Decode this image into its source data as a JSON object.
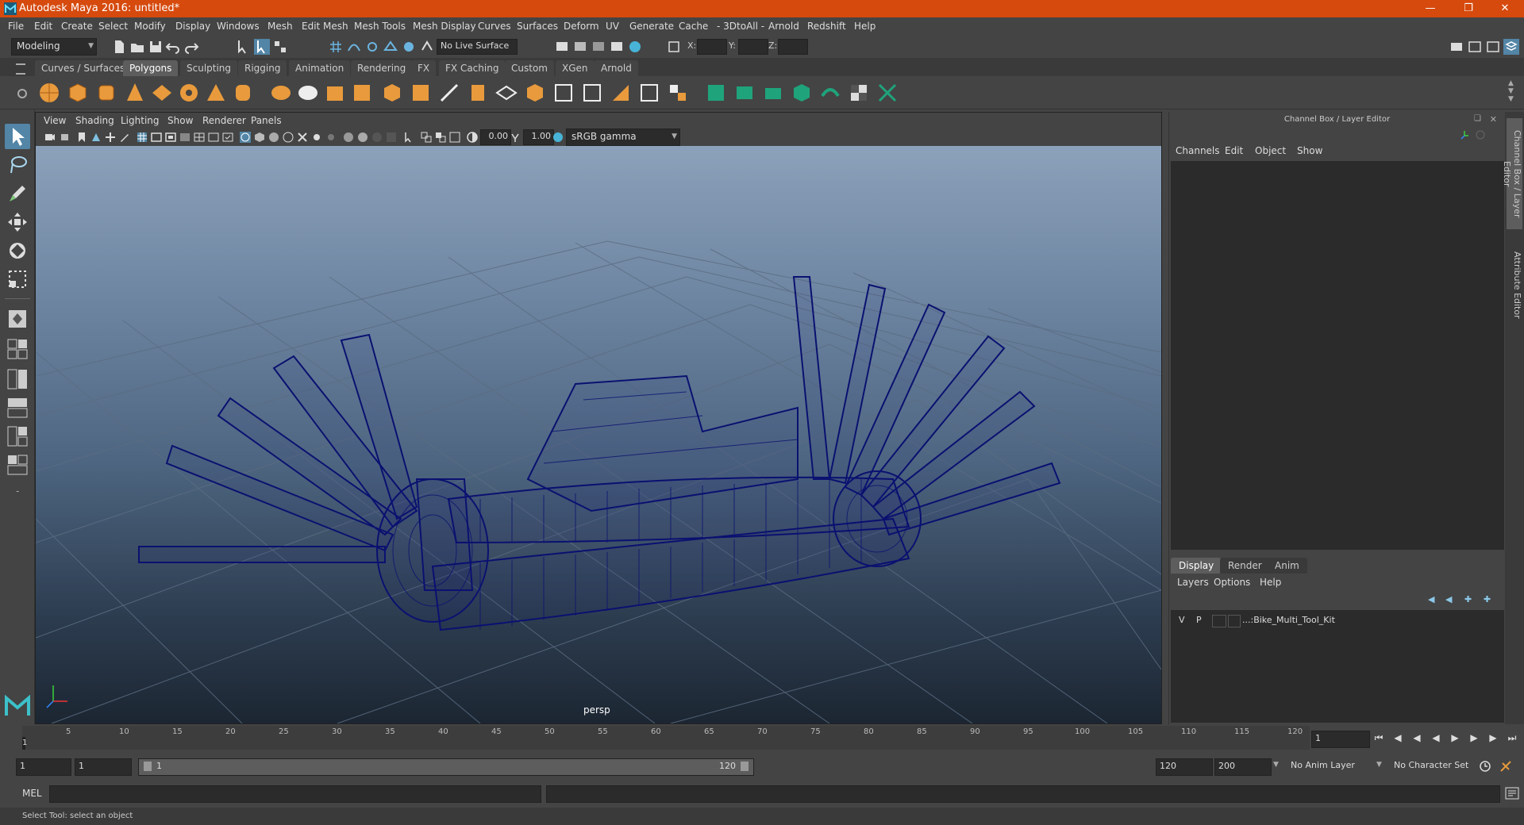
{
  "window": {
    "title": "Autodesk Maya 2016: untitled*"
  },
  "menubar": [
    "File",
    "Edit",
    "Create",
    "Select",
    "Modify",
    "Display",
    "Windows",
    "Mesh",
    "Edit Mesh",
    "Mesh Tools",
    "Mesh Display",
    "Curves",
    "Surfaces",
    "Deform",
    "UV",
    "Generate",
    "Cache",
    "- 3DtoAll -",
    "Arnold",
    "Redshift",
    "Help"
  ],
  "statusline": {
    "menuset": "Modeling",
    "live_surface": "No Live Surface",
    "x_label": "X:",
    "y_label": "Y:",
    "z_label": "Z:"
  },
  "shelf_tabs": [
    "Curves / Surfaces",
    "Polygons",
    "Sculpting",
    "Rigging",
    "Animation",
    "Rendering",
    "FX",
    "FX Caching",
    "Custom",
    "XGen",
    "Arnold"
  ],
  "active_shelf": "Polygons",
  "viewport": {
    "menu": [
      "View",
      "Shading",
      "Lighting",
      "Show",
      "Renderer",
      "Panels"
    ],
    "exposure": "0.00",
    "gamma": "1.00",
    "colorspace": "sRGB gamma",
    "camera": "persp"
  },
  "channel_box": {
    "title": "Channel Box / Layer Editor",
    "menu": [
      "Channels",
      "Edit",
      "Object",
      "Show"
    ],
    "layer_tabs": [
      "Display",
      "Render",
      "Anim"
    ],
    "active_layer_tab": "Display",
    "layer_menu": [
      "Layers",
      "Options",
      "Help"
    ],
    "layer": {
      "v": "V",
      "p": "P",
      "name": "...:Bike_Multi_Tool_Kit"
    }
  },
  "side_tabs": [
    "Channel Box / Layer Editor",
    "Attribute Editor"
  ],
  "time_slider": {
    "ticks": [
      "5",
      "10",
      "15",
      "20",
      "25",
      "30",
      "35",
      "40",
      "45",
      "50",
      "55",
      "60",
      "65",
      "70",
      "75",
      "80",
      "85",
      "90",
      "95",
      "100",
      "105",
      "110",
      "115",
      "120"
    ],
    "start_marker": "1",
    "current_frame": "1"
  },
  "range_slider": {
    "start": "1",
    "playback_start": "1",
    "range_start_label": "1",
    "range_end_label": "120",
    "playback_end": "120",
    "end": "200",
    "anim_layer": "No Anim Layer",
    "character_set": "No Character Set"
  },
  "command_line": {
    "label": "MEL"
  },
  "help_line": "Select Tool: select an object",
  "colors": {
    "title_bar": "#d64a0e",
    "wireframe": "#0a1170",
    "active_tool": "#5285a6"
  }
}
